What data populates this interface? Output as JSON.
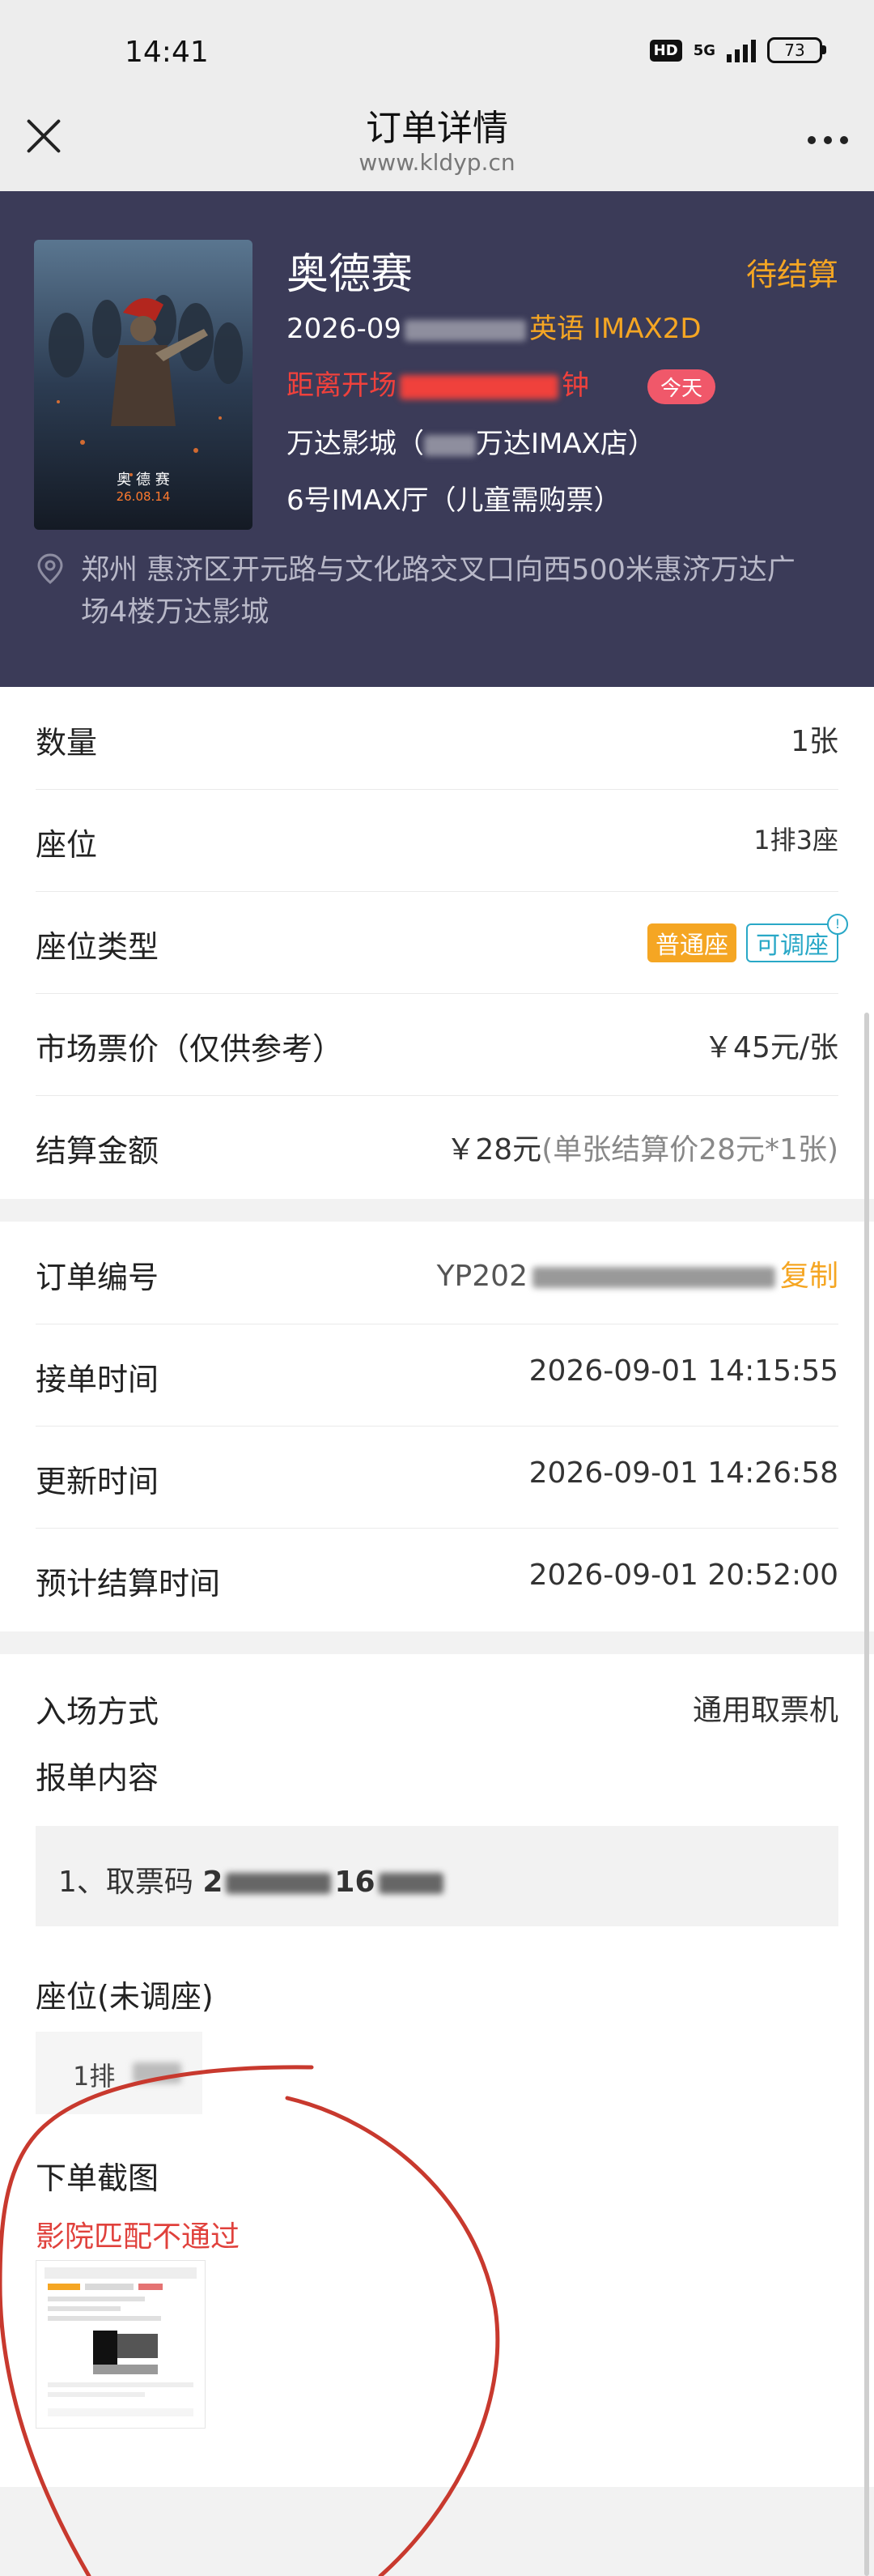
{
  "status_bar": {
    "time": "14:41",
    "hd": "HD",
    "network": "5G",
    "battery": "73"
  },
  "nav": {
    "title": "订单详情",
    "url": "www.kldyp.cn"
  },
  "movie": {
    "poster_title": "奥 德 赛",
    "poster_date": "26.08.14",
    "title": "奥德赛",
    "status": "待结算",
    "show_date_prefix": "2026-09",
    "show_lang": "英语 IMAX2D",
    "countdown_prefix": "距离开场",
    "countdown_suffix": "钟",
    "today_badge": "今天",
    "cinema_prefix": "万达影城（",
    "cinema_suffix": "万达IMAX店）",
    "hall": "6号IMAX厅（儿童需购票）",
    "address": "郑州 惠济区开元路与文化路交叉口向西500米惠济万达广场4楼万达影城"
  },
  "details": {
    "quantity": {
      "label": "数量",
      "value": "1张"
    },
    "seat": {
      "label": "座位",
      "value": "1排3座"
    },
    "seat_type": {
      "label": "座位类型",
      "normal": "普通座",
      "adjustable": "可调座",
      "info_icon": "!"
    },
    "market_price": {
      "label": "市场票价（仅供参考）",
      "value": "￥45元/张"
    },
    "settle_amount": {
      "label": "结算金额",
      "value": "￥28元",
      "note": "(单张结算价28元*1张)"
    }
  },
  "order": {
    "order_no": {
      "label": "订单编号",
      "value_prefix": "YP202",
      "copy": "复制"
    },
    "accept_time": {
      "label": "接单时间",
      "value": "2026-09-01 14:15:55"
    },
    "update_time": {
      "label": "更新时间",
      "value": "2026-09-01 14:26:58"
    },
    "settle_time": {
      "label": "预计结算时间",
      "value": "2026-09-01 20:52:00"
    }
  },
  "entry": {
    "method_label": "入场方式",
    "method_value": "通用取票机",
    "report_label": "报单内容",
    "code_prefix": "1、取票码",
    "code_partial_a": "2",
    "code_partial_b": "16",
    "seat_unadjusted_label": "座位(未调座)",
    "seat_chip_text": "1排",
    "screenshot_label": "下单截图",
    "warning": "影院匹配不通过"
  },
  "colors": {
    "header_bg": "#3b3b58",
    "accent": "#f5a623",
    "alert": "#f0413c",
    "teal": "#29a8c7"
  }
}
